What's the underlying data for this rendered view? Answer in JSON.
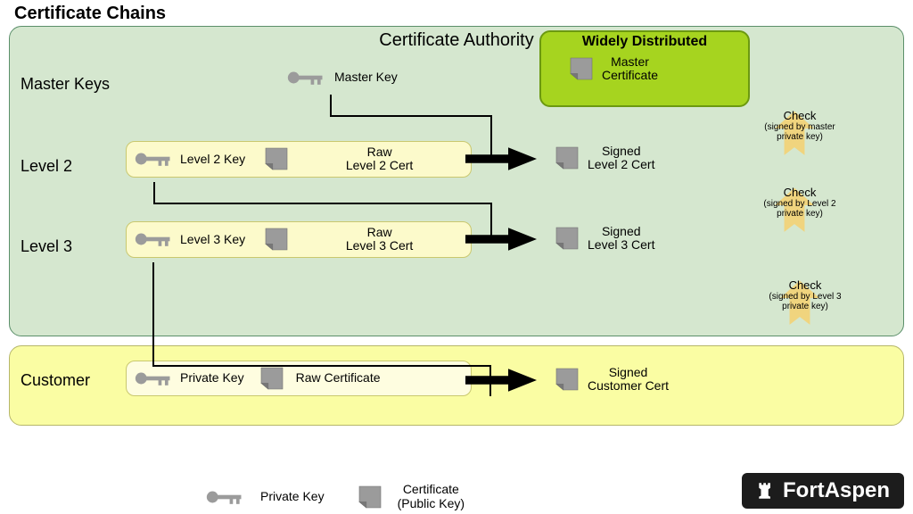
{
  "title": "Certificate Chains",
  "ca_header": "Certificate Authority",
  "rows": {
    "master": "Master Keys",
    "l2": "Level 2",
    "l3": "Level 3",
    "cust": "Customer"
  },
  "master_key": "Master Key",
  "wd_title": "Widely Distributed",
  "master_cert": "Master\nCertificate",
  "l2_key": "Level 2 Key",
  "l2_raw": "Raw\nLevel 2 Cert",
  "l2_signed": "Signed\nLevel 2 Cert",
  "l3_key": "Level 3 Key",
  "l3_raw": "Raw\nLevel 3 Cert",
  "l3_signed": "Signed\nLevel 3 Cert",
  "priv_key": "Private Key",
  "raw_cert": "Raw Certificate",
  "cust_signed": "Signed\nCustomer Cert",
  "check": "Check",
  "chk1": "(signed by master\nprivate key)",
  "chk2": "(signed by Level 2\nprivate key)",
  "chk3": "(signed by Level 3\nprivate key)",
  "legend_key": "Private Key",
  "legend_cert": "Certificate\n(Public Key)",
  "brand": "FortAspen"
}
